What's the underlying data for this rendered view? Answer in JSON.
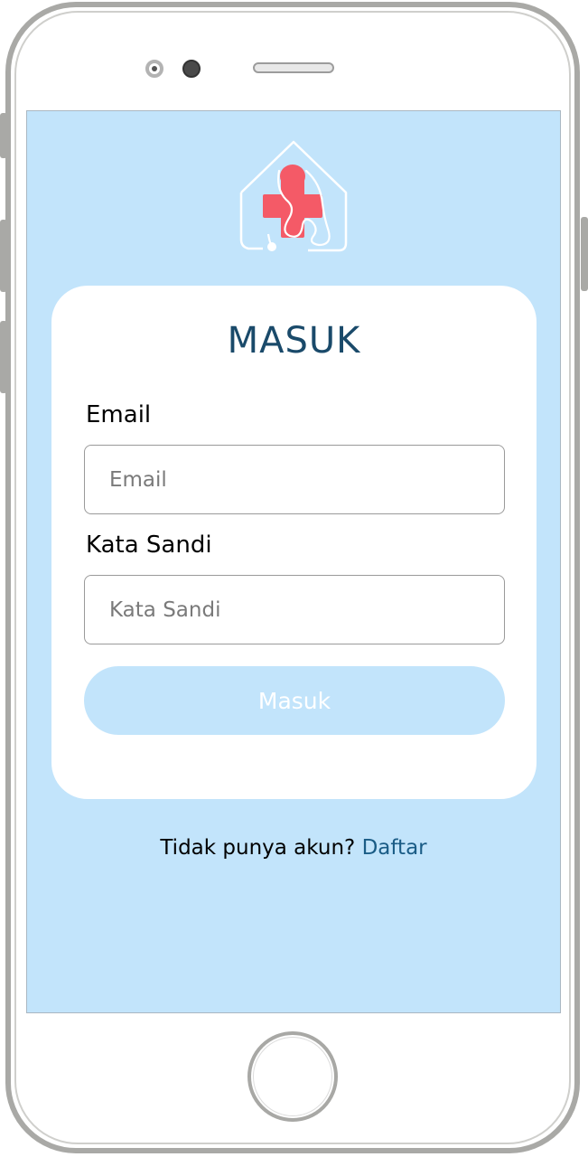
{
  "app": {
    "logo_icon": "home-medical-cross-stethoscope-icon"
  },
  "login": {
    "title": "MASUK",
    "email_label": "Email",
    "email_placeholder": "Email",
    "password_label": "Kata Sandi",
    "password_placeholder": "Kata Sandi",
    "submit_label": "Masuk"
  },
  "footer": {
    "prompt": "Tidak punya akun?",
    "signup_link": "Daftar"
  },
  "colors": {
    "screen_background": "#c2e4fb",
    "title": "#1a4a6a",
    "link": "#1a5c86",
    "logo_cross": "#f45a67"
  }
}
